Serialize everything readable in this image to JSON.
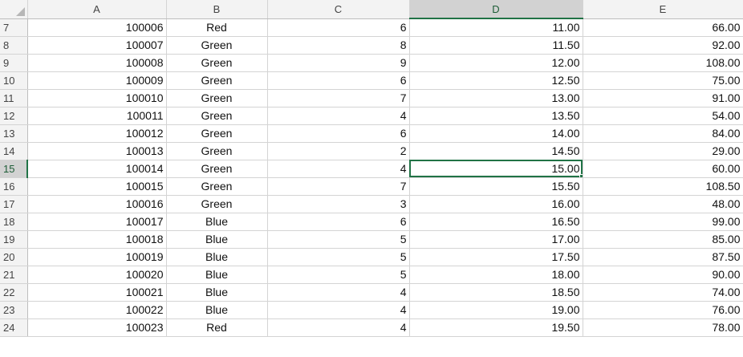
{
  "columns": [
    "A",
    "B",
    "C",
    "D",
    "E"
  ],
  "rows": [
    {
      "n": "7",
      "a": "100006",
      "b": "Red",
      "c": "6",
      "d": "11.00",
      "e": "66.00"
    },
    {
      "n": "8",
      "a": "100007",
      "b": "Green",
      "c": "8",
      "d": "11.50",
      "e": "92.00"
    },
    {
      "n": "9",
      "a": "100008",
      "b": "Green",
      "c": "9",
      "d": "12.00",
      "e": "108.00"
    },
    {
      "n": "10",
      "a": "100009",
      "b": "Green",
      "c": "6",
      "d": "12.50",
      "e": "75.00"
    },
    {
      "n": "11",
      "a": "100010",
      "b": "Green",
      "c": "7",
      "d": "13.00",
      "e": "91.00"
    },
    {
      "n": "12",
      "a": "100011",
      "b": "Green",
      "c": "4",
      "d": "13.50",
      "e": "54.00"
    },
    {
      "n": "13",
      "a": "100012",
      "b": "Green",
      "c": "6",
      "d": "14.00",
      "e": "84.00"
    },
    {
      "n": "14",
      "a": "100013",
      "b": "Green",
      "c": "2",
      "d": "14.50",
      "e": "29.00"
    },
    {
      "n": "15",
      "a": "100014",
      "b": "Green",
      "c": "4",
      "d": "15.00",
      "e": "60.00"
    },
    {
      "n": "16",
      "a": "100015",
      "b": "Green",
      "c": "7",
      "d": "15.50",
      "e": "108.50"
    },
    {
      "n": "17",
      "a": "100016",
      "b": "Green",
      "c": "3",
      "d": "16.00",
      "e": "48.00"
    },
    {
      "n": "18",
      "a": "100017",
      "b": "Blue",
      "c": "6",
      "d": "16.50",
      "e": "99.00"
    },
    {
      "n": "19",
      "a": "100018",
      "b": "Blue",
      "c": "5",
      "d": "17.00",
      "e": "85.00"
    },
    {
      "n": "20",
      "a": "100019",
      "b": "Blue",
      "c": "5",
      "d": "17.50",
      "e": "87.50"
    },
    {
      "n": "21",
      "a": "100020",
      "b": "Blue",
      "c": "5",
      "d": "18.00",
      "e": "90.00"
    },
    {
      "n": "22",
      "a": "100021",
      "b": "Blue",
      "c": "4",
      "d": "18.50",
      "e": "74.00"
    },
    {
      "n": "23",
      "a": "100022",
      "b": "Blue",
      "c": "4",
      "d": "19.00",
      "e": "76.00"
    },
    {
      "n": "24",
      "a": "100023",
      "b": "Red",
      "c": "4",
      "d": "19.50",
      "e": "78.00"
    }
  ],
  "selection": {
    "column": "D",
    "row": "15"
  },
  "colors": {
    "accent": "#217346",
    "header_bg": "#f3f3f3",
    "active_header_bg": "#d2d2d2",
    "grid": "#d4d4d4"
  },
  "icons": {
    "corner": "select-all-triangle-icon"
  }
}
